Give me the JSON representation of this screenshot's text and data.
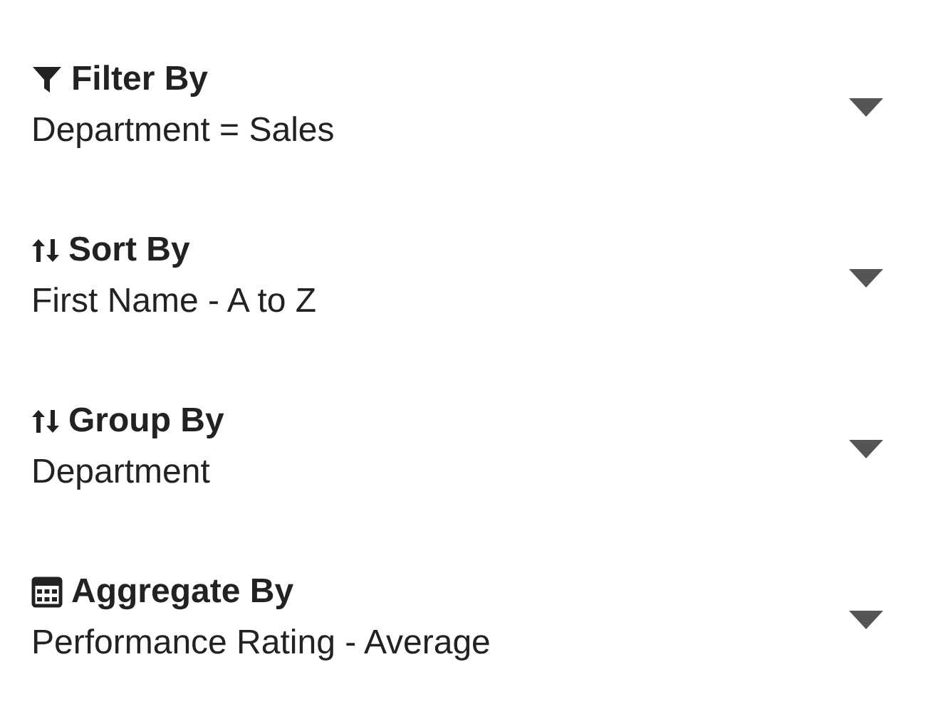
{
  "options": [
    {
      "kind": "filter",
      "title": "Filter By",
      "value": "Department = Sales"
    },
    {
      "kind": "sort",
      "title": "Sort By",
      "value": "First Name - A to Z"
    },
    {
      "kind": "group",
      "title": "Group By",
      "value": "Department"
    },
    {
      "kind": "aggregate",
      "title": "Aggregate By",
      "value": "Performance Rating - Average"
    }
  ]
}
